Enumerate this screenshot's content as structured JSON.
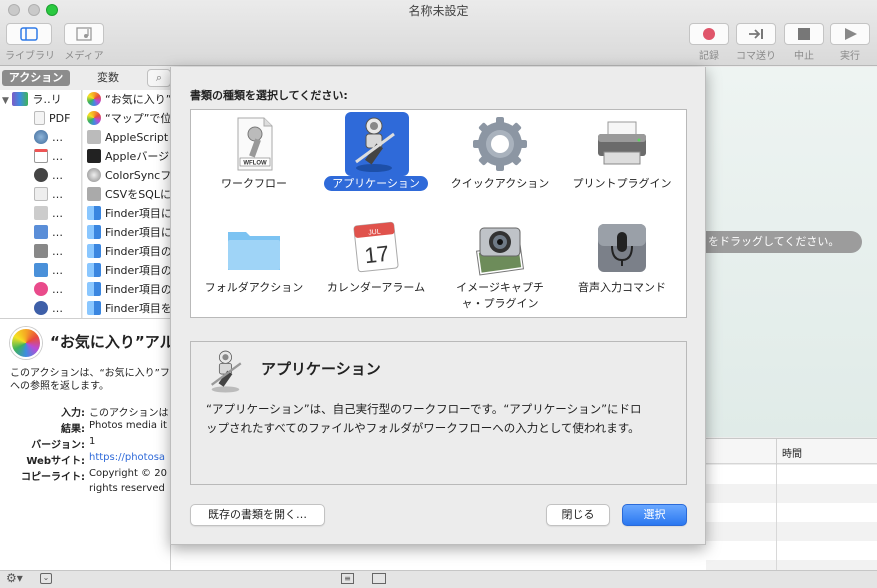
{
  "window": {
    "title": "名称未設定"
  },
  "toolbar": {
    "library": "ライブラリ",
    "media": "メディア",
    "record": "記録",
    "step": "コマ送り",
    "stop": "中止",
    "run": "実行"
  },
  "library_tabs": {
    "actions": "アクション",
    "variables": "変数"
  },
  "library_items": [
    {
      "label": "ラ‥リ"
    },
    {
      "label": "PDF"
    },
    {
      "label": "…"
    },
    {
      "label": "…"
    },
    {
      "label": "…"
    },
    {
      "label": "…"
    },
    {
      "label": "…"
    },
    {
      "label": "…"
    },
    {
      "label": "…"
    },
    {
      "label": "…"
    },
    {
      "label": "…"
    },
    {
      "label": "…"
    }
  ],
  "action_items": [
    {
      "label": "“お気に入り”フ"
    },
    {
      "label": "“マップ”で位置"
    },
    {
      "label": "AppleScript"
    },
    {
      "label": "Appleバージ"
    },
    {
      "label": "ColorSyncフ"
    },
    {
      "label": "CSVをSQLに"
    },
    {
      "label": "Finder項目に"
    },
    {
      "label": "Finder項目に"
    },
    {
      "label": "Finder項目の"
    },
    {
      "label": "Finder項目の"
    },
    {
      "label": "Finder項目の"
    },
    {
      "label": "Finder項目を"
    }
  ],
  "description": {
    "title": "“お気に入り”アル",
    "body_line1": "このアクションは、“お気に入り”フ",
    "body_line2": "への参照を返します。",
    "fields": [
      {
        "key": "入力:",
        "value": "このアクションは"
      },
      {
        "key": "結果:",
        "value": "Photos media it"
      },
      {
        "key": "バージョン:",
        "value": "1"
      },
      {
        "key": "Webサイト:",
        "value": "https://photosa"
      },
      {
        "key": "コピーライト:",
        "value": "Copyright © 20"
      }
    ],
    "copyright_line2": "rights reserved"
  },
  "workflow": {
    "drag_hint": "をドラッグしてください。",
    "log_time_header": "時間"
  },
  "sheet": {
    "prompt": "書類の種類を選択してください:",
    "doc_types": [
      {
        "label": "ワークフロー",
        "icon": "workflow-icon"
      },
      {
        "label": "アプリケーション",
        "icon": "application-icon",
        "selected": true
      },
      {
        "label": "クイックアクション",
        "icon": "gear-icon"
      },
      {
        "label": "プリントプラグイン",
        "icon": "printer-icon"
      },
      {
        "label": "フォルダアクション",
        "icon": "folder-icon"
      },
      {
        "label": "カレンダーアラーム",
        "icon": "calendar-icon"
      },
      {
        "label": "イメージキャプチャ・プラグイン",
        "label_line1": "イメージキャプチ",
        "label_line2": "ャ・プラグイン",
        "icon": "camera-icon"
      },
      {
        "label": "音声入力コマンド",
        "icon": "microphone-icon"
      }
    ],
    "wflow_badge": "WFLOW",
    "calendar_month": "JUL",
    "calendar_day": "17",
    "info_title": "アプリケーション",
    "info_text_line1": "“アプリケーション”は、自己実行型のワークフローです。“アプリケーション”にドロ",
    "info_text_line2": "ップされたすべてのファイルやフォルダがワークフローへの入力として使われます。",
    "open_existing": "既存の書類を開く…",
    "close": "閉じる",
    "choose": "選択"
  },
  "colors": {
    "accent": "#2f6ad9",
    "zoom_green": "#2ac940",
    "record_red": "#e0556a"
  }
}
